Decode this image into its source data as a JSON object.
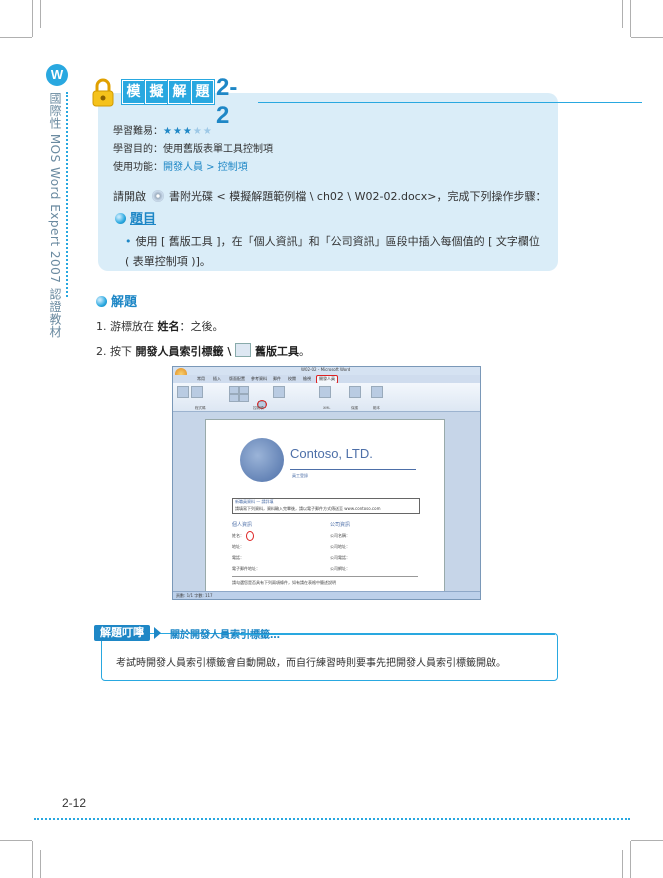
{
  "sidebar": {
    "logo_letter": "W",
    "vertical_text": "國際性 MOS Word Expert 2007 認證教材"
  },
  "header": {
    "tag_chars": [
      "模",
      "擬",
      "解",
      "題"
    ],
    "number": "2-2"
  },
  "meta": {
    "difficulty_label": "學習難易：",
    "stars_filled": "★★★",
    "stars_empty": "★★",
    "goal_label": "學習目的：",
    "goal_value": "使用舊版表單工具控制項",
    "function_label": "使用功能：",
    "function_value": "開發人員 > 控制項"
  },
  "instruction": {
    "prefix": "請開啟",
    "rest": "書附光碟 < 模擬解題範例檔 \\ ch02 \\ W02-02.docx>，完成下列操作步驟："
  },
  "question": {
    "heading": "題目",
    "text": "使用 [ 舊版工具 ]，在「個人資訊」和「公司資訊」區段中插入每個值的 [ 文字欄位 ( 表單控制項 )]。"
  },
  "solution": {
    "heading": "解題",
    "step1_prefix": "1.  游標放在 ",
    "step1_bold": "姓名",
    "step1_suffix": "：之後。",
    "step2_prefix": "2.  按下 ",
    "step2_bold1": "開發人員索引標籤 \\ ",
    "step2_bold2": " 舊版工具",
    "step2_suffix": "。"
  },
  "screenshot": {
    "window_title": "W02-02 - Microsoft Word",
    "tabs": [
      "常用",
      "插入",
      "版面配置",
      "參考資料",
      "郵件",
      "校閱",
      "檢視",
      "開發人員"
    ],
    "ribbon_groups": [
      "程式碼",
      "控制項",
      "XML",
      "保護",
      "範本"
    ],
    "company": "Contoso, LTD.",
    "subtitle": "員工登錄",
    "box_heading": "新職員資料 — 請詳填",
    "box_text": "請填寫下列資料，資料輸入完畢後，請以電子郵件方式傳送至 www.contoso.com",
    "personal_heading": "個人資訊",
    "company_heading": "公司資訊",
    "personal_fields": [
      "姓名：",
      "地址：",
      "電話：",
      "電子郵件地址："
    ],
    "company_fields": [
      "公司名稱：",
      "公司地址：",
      "公司電話：",
      "公司網址："
    ],
    "note": "請勾選您是否具有下列兩項條件，如有請在表格中簡述說明",
    "status": "頁數: 1/1   字數: 117"
  },
  "tip": {
    "tag": "解題叮嚀",
    "title": "關於開發人員索引標籤…",
    "body": "考試時開發人員索引標籤會自動開啟，而自行練習時則要事先把開發人員索引標籤開啟。"
  },
  "footer": {
    "page_number": "2-12"
  }
}
